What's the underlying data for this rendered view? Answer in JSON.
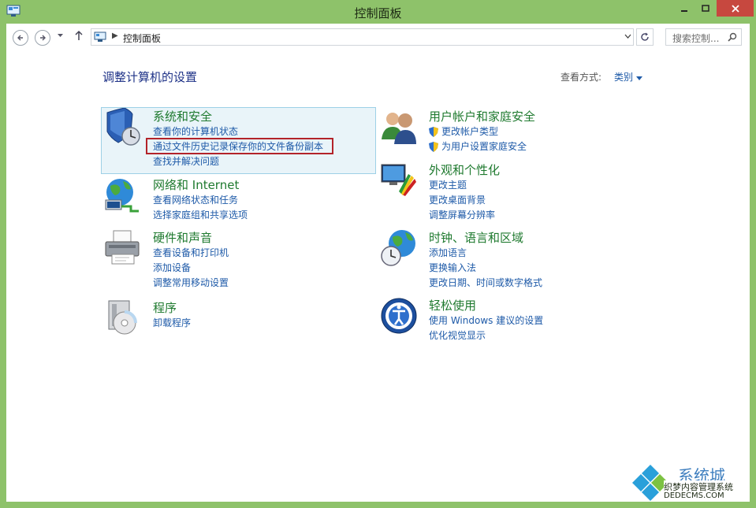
{
  "window": {
    "title": "控制面板"
  },
  "navbar": {
    "address": "控制面板",
    "search_placeholder": "搜索控制..."
  },
  "main": {
    "heading": "调整计算机的设置",
    "view_by_label": "查看方式:",
    "view_by_value": "类别"
  },
  "categories": [
    {
      "title": "系统和安全",
      "icon": "shield-clock-icon",
      "links": [
        "查看你的计算机状态",
        "通过文件历史记录保存你的文件备份副本",
        "查找并解决问题"
      ]
    },
    {
      "title": "网络和 Internet",
      "icon": "globe-network-icon",
      "links": [
        "查看网络状态和任务",
        "选择家庭组和共享选项"
      ]
    },
    {
      "title": "硬件和声音",
      "icon": "printer-icon",
      "links": [
        "查看设备和打印机",
        "添加设备",
        "调整常用移动设置"
      ]
    },
    {
      "title": "程序",
      "icon": "program-disc-icon",
      "links": [
        "卸载程序"
      ]
    },
    {
      "title": "用户帐户和家庭安全",
      "icon": "users-icon",
      "links": [
        "更改帐户类型",
        "为用户设置家庭安全"
      ]
    },
    {
      "title": "外观和个性化",
      "icon": "monitor-palette-icon",
      "links": [
        "更改主题",
        "更改桌面背景",
        "调整屏幕分辨率"
      ]
    },
    {
      "title": "时钟、语言和区域",
      "icon": "globe-clock-icon",
      "links": [
        "添加语言",
        "更换输入法",
        "更改日期、时间或数字格式"
      ]
    },
    {
      "title": "轻松使用",
      "icon": "accessibility-icon",
      "links": [
        "使用 Windows 建议的设置",
        "优化视觉显示"
      ]
    }
  ],
  "watermark": {
    "line1": "系统城",
    "line2": "织梦内容管理系统",
    "line3": "DEDECMS.COM"
  },
  "colors": {
    "window_frame": "#8ec26a",
    "link": "#1e5aa8",
    "category_title": "#1f7a2f",
    "heading": "#1e3287",
    "highlight_border": "#b3232a"
  }
}
